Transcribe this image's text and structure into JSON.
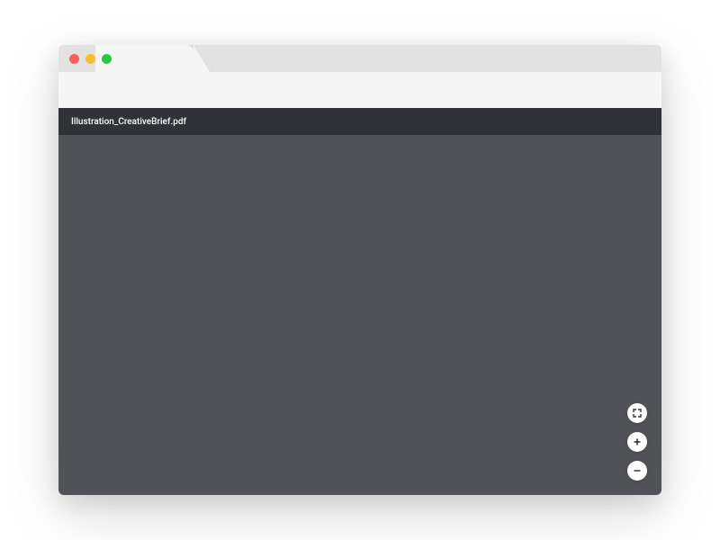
{
  "toolbar": {
    "title": "Illustration_CreativeBrief.pdf"
  },
  "zoom": {
    "fit_label": "fit-to-page",
    "in_label": "zoom-in",
    "out_label": "zoom-out"
  }
}
